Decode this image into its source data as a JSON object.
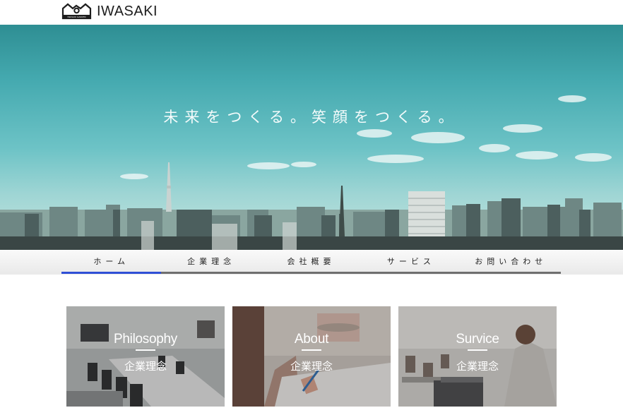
{
  "brand": {
    "name": "IWASAKI",
    "logo_small_text": "IWASAKI GAKKEN",
    "logo_icon": "house-smile-logo-icon"
  },
  "hero": {
    "tagline": "未来をつくる。笑顔をつくる。"
  },
  "nav": {
    "items": [
      {
        "label": "ホーム",
        "active": true
      },
      {
        "label": "企業理念",
        "active": false
      },
      {
        "label": "会社概要",
        "active": false
      },
      {
        "label": "サービス",
        "active": false
      },
      {
        "label": "お問い合わせ",
        "active": false
      }
    ],
    "active_color": "#2f4fd6"
  },
  "cards": [
    {
      "title": "Philosophy",
      "subtitle": "企業理念"
    },
    {
      "title": "About",
      "subtitle": "企業理念"
    },
    {
      "title": "Survice",
      "subtitle": "企業理念"
    }
  ]
}
